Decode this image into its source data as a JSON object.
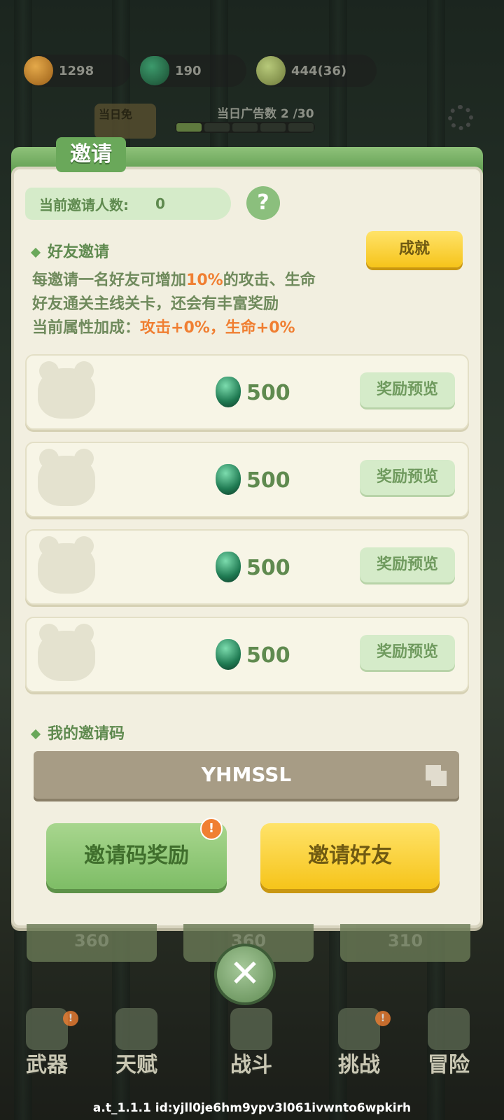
{
  "hud": {
    "paw_count": "1298",
    "gem_count": "190",
    "bamboo_count": "444(36)",
    "ad_label": "当日广告数",
    "ad_count": "2 /30",
    "ad_box_label": "当日免"
  },
  "panel": {
    "title": "邀请",
    "invite_count_label": "当前邀请人数:",
    "invite_count_value": "0",
    "help_label": "?",
    "friend_section_title": "好友邀请",
    "achievement_button": "成就",
    "desc_line1_pre": "每邀请一名好友可增加",
    "desc_line1_percent": "10%",
    "desc_line1_post": "的攻击、生命",
    "desc_line2": "好友通关主线关卡，还会有丰富奖励",
    "desc_line3_pre": "当前属性加成：",
    "desc_line3_bonus": "攻击+0%，生命+0%",
    "rewards": [
      {
        "amount": "500",
        "button": "奖励预览"
      },
      {
        "amount": "500",
        "button": "奖励预览"
      },
      {
        "amount": "500",
        "button": "奖励预览"
      },
      {
        "amount": "500",
        "button": "奖励预览"
      }
    ],
    "code_section_title": "我的邀请码",
    "invite_code": "YHMSSL",
    "code_reward_button": "邀请码奖励",
    "code_reward_badge": "!",
    "invite_friend_button": "邀请好友"
  },
  "background_cards": [
    "360",
    "360",
    "310"
  ],
  "close_label": "✕",
  "nav": [
    {
      "label": "武器"
    },
    {
      "label": "天赋"
    },
    {
      "label": "战斗"
    },
    {
      "label": "挑战"
    },
    {
      "label": "冒险"
    }
  ],
  "footer": "a.t_1.1.1 id:yjll0je6hm9ypv3l061ivwnto6wpkirh",
  "colors": {
    "accent_green": "#6aa85a",
    "highlight_orange": "#f07f32",
    "button_yellow": "#f6c41a",
    "panel_bg": "#f2efe0"
  }
}
